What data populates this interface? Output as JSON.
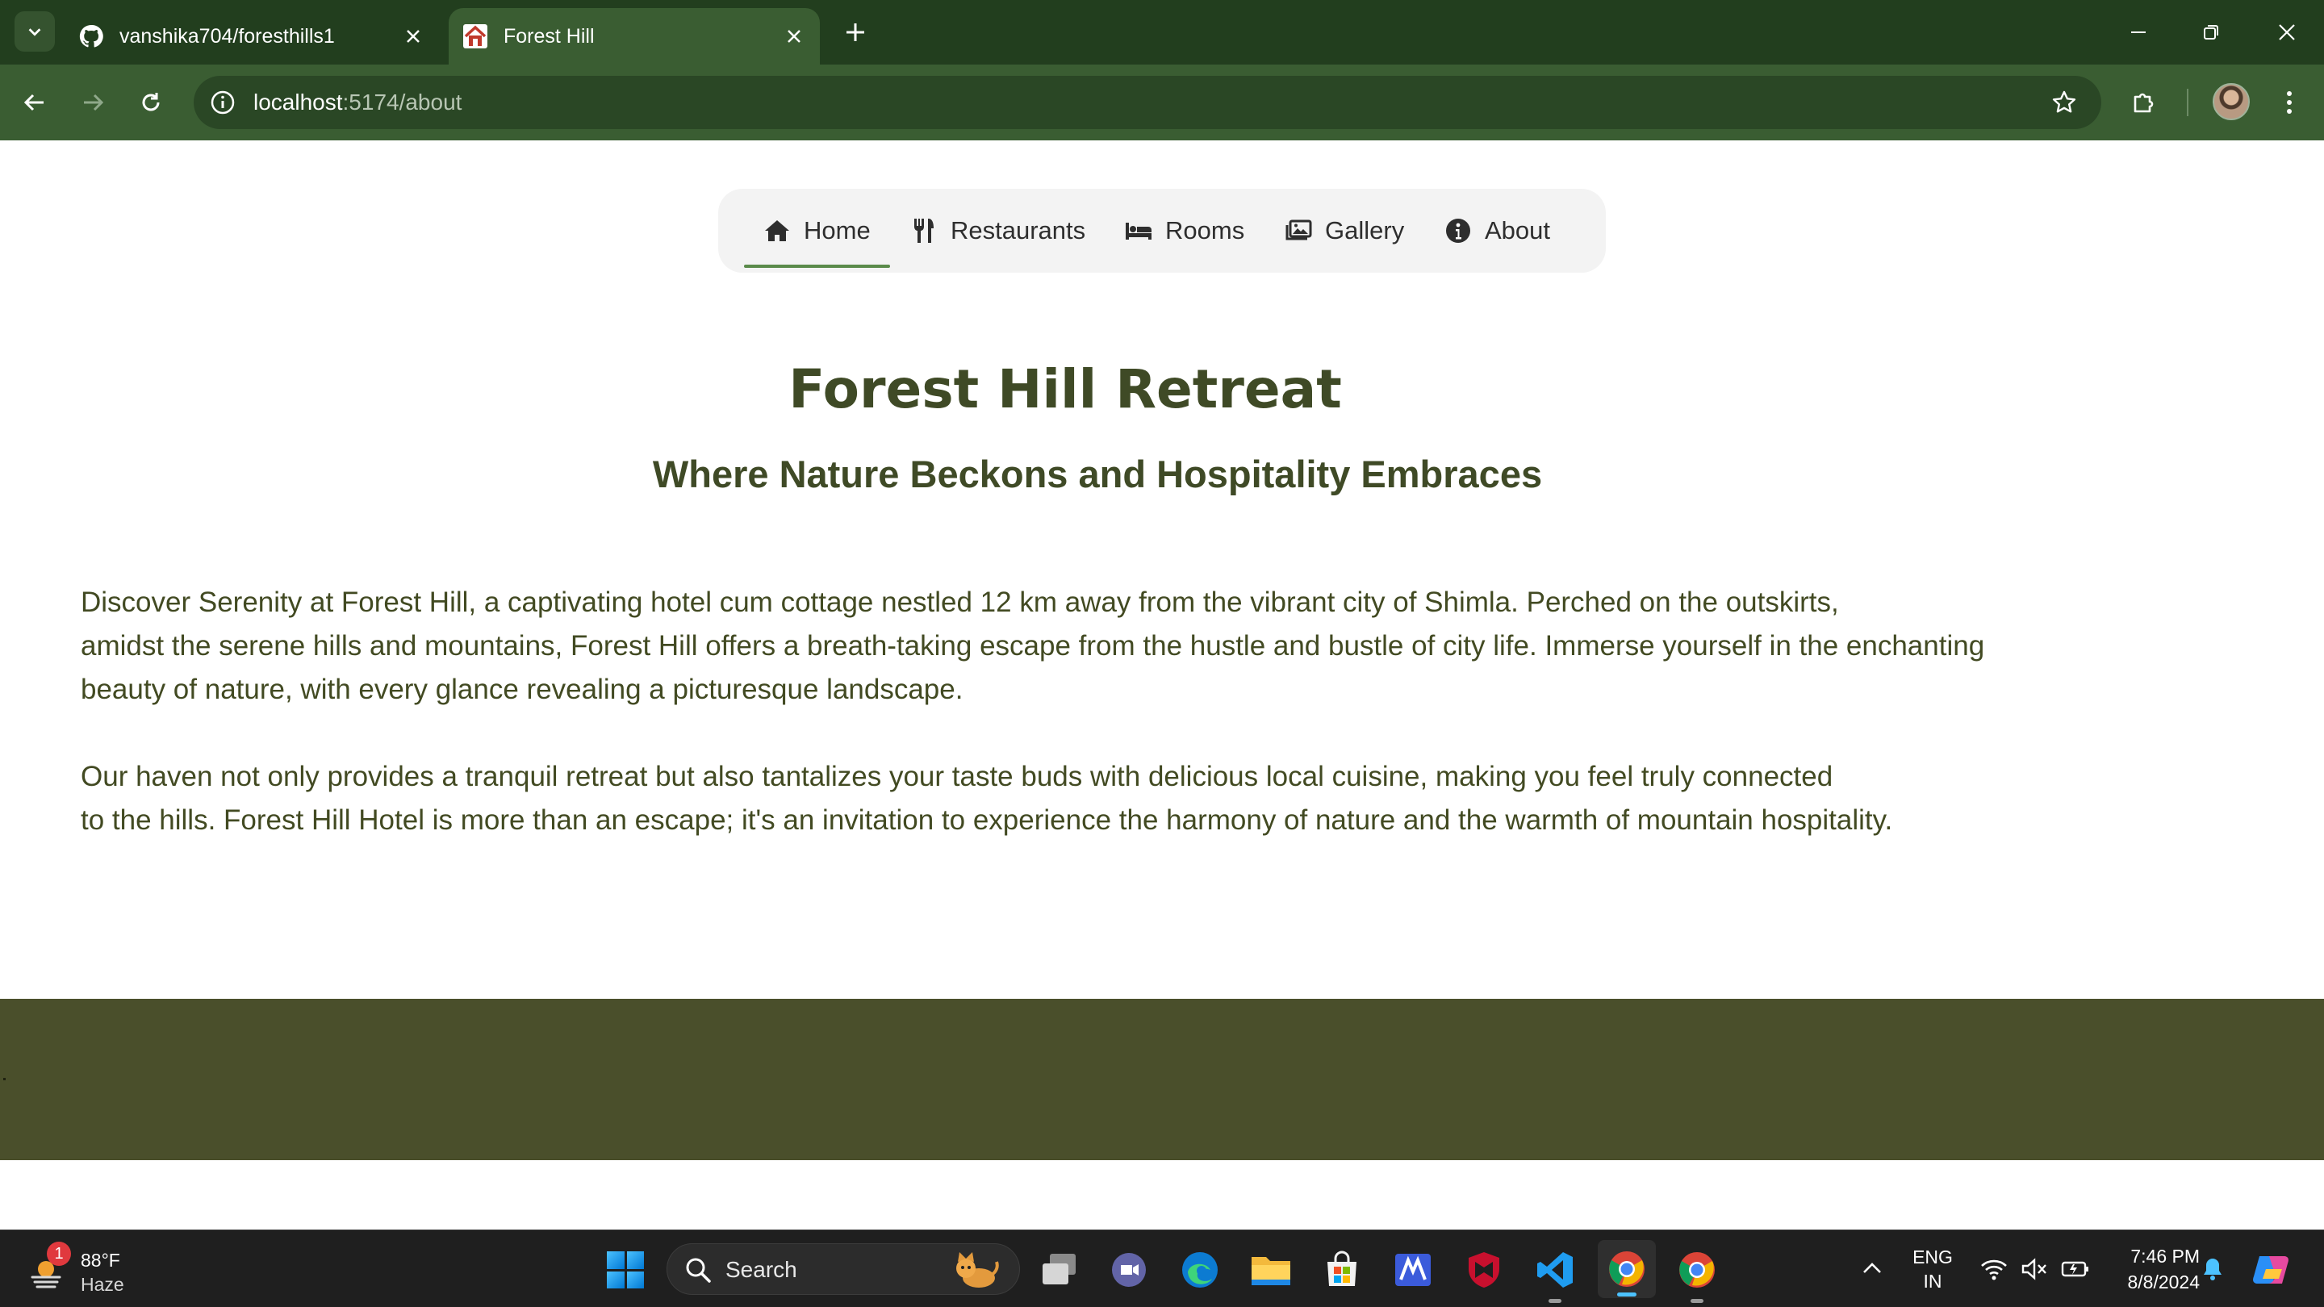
{
  "browser": {
    "tabs": [
      {
        "title": "vanshika704/foresthills1",
        "icon": "github-icon"
      },
      {
        "title": "Forest Hill",
        "icon": "house-icon"
      }
    ],
    "url_host": "localhost",
    "url_path": ":5174/about"
  },
  "nav": {
    "items": [
      {
        "label": "Home",
        "icon": "home-icon"
      },
      {
        "label": "Restaurants",
        "icon": "utensils-icon"
      },
      {
        "label": "Rooms",
        "icon": "bed-icon"
      },
      {
        "label": "Gallery",
        "icon": "images-icon"
      },
      {
        "label": "About",
        "icon": "info-icon"
      }
    ],
    "active": "Home"
  },
  "hero": {
    "title": "Forest Hill Retreat",
    "subtitle": "Where Nature Beckons and Hospitality Embraces"
  },
  "about": {
    "paragraph1": [
      "Discover Serenity at Forest Hill, a captivating hotel cum cottage nestled 12 km away from the vibrant city of Shimla. Perched on the outskirts,",
      "amidst the serene hills and mountains, Forest Hill offers a breath-taking escape from the hustle and bustle of city life. Immerse yourself in the enchanting",
      "beauty of nature, with every glance revealing a picturesque landscape."
    ],
    "paragraph2": [
      "Our haven not only provides a tranquil retreat but also tantalizes your taste buds with delicious local cuisine, making you feel truly connected",
      "to the hills. Forest Hill Hotel is more than an escape; it's an invitation to experience the harmony of nature and the warmth of mountain hospitality."
    ]
  },
  "taskbar": {
    "weather_badge": "1",
    "weather_temp": "88°F",
    "weather_condition": "Haze",
    "search_label": "Search",
    "lang_line1": "ENG",
    "lang_line2": "IN",
    "time": "7:46 PM",
    "date": "8/8/2024"
  },
  "colors": {
    "tabstrip": "#223e1e",
    "toolbar": "#3a5d32",
    "heading": "#3f4a26",
    "body_text": "#424a22",
    "footer": "#4a4f2b",
    "nav_active_underline": "#5a8a4a"
  }
}
